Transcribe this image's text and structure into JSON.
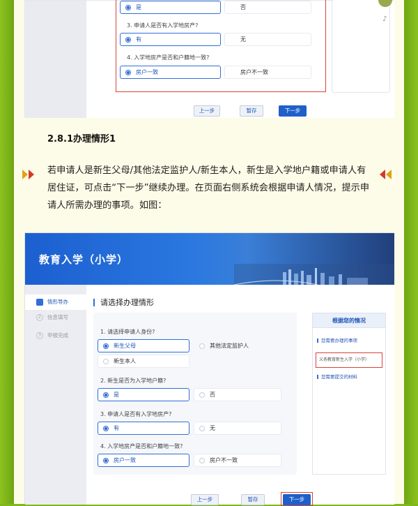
{
  "top_form": {
    "q1_opt_yes": "是",
    "q1_opt_no": "否",
    "q3": "3. 申请人是否有入学地房产?",
    "q3_opt_yes": "有",
    "q3_opt_no": "无",
    "q4": "4. 入学地房产是否和户籍地一致?",
    "q4_opt_yes": "房户一致",
    "q4_opt_no": "房户不一致",
    "prev": "上一步",
    "save": "暂存",
    "next": "下一步"
  },
  "section_heading": "2.8.1办理情形1",
  "paragraph": "若申请人是新生父母/其他法定监护人/新生本人，新生是入学地户籍或申请人有居住证，可点击“下一步”继续办理。在页面右侧系统会根据申请人情况，提示申请人所需办理的事项。如图：",
  "shot": {
    "banner_title": "教育入学（小学）",
    "nav": [
      "情形导办",
      "信息填写",
      "申报完成"
    ],
    "content_title": "请选择办理情形",
    "q1": "1. 请选择申请人身份?",
    "q1_opts": [
      "新生父母",
      "其他法定监护人",
      "新生本人"
    ],
    "q2": "2. 新生是否为入学地户籍?",
    "q2_opts": [
      "是",
      "否"
    ],
    "q3": "3. 申请人是否有入学地房产?",
    "q3_opts": [
      "有",
      "无"
    ],
    "q4": "4. 入学地房产是否和户籍地一致?",
    "q4_opts": [
      "房户一致",
      "房户不一致"
    ],
    "guide_title": "根据您的情况",
    "guide_items": [
      "您需要办理的事项",
      "义务教育新生入学（小学）",
      "您需要提交的材料"
    ],
    "prev": "上一步",
    "save": "暂存",
    "next": "下一步"
  }
}
